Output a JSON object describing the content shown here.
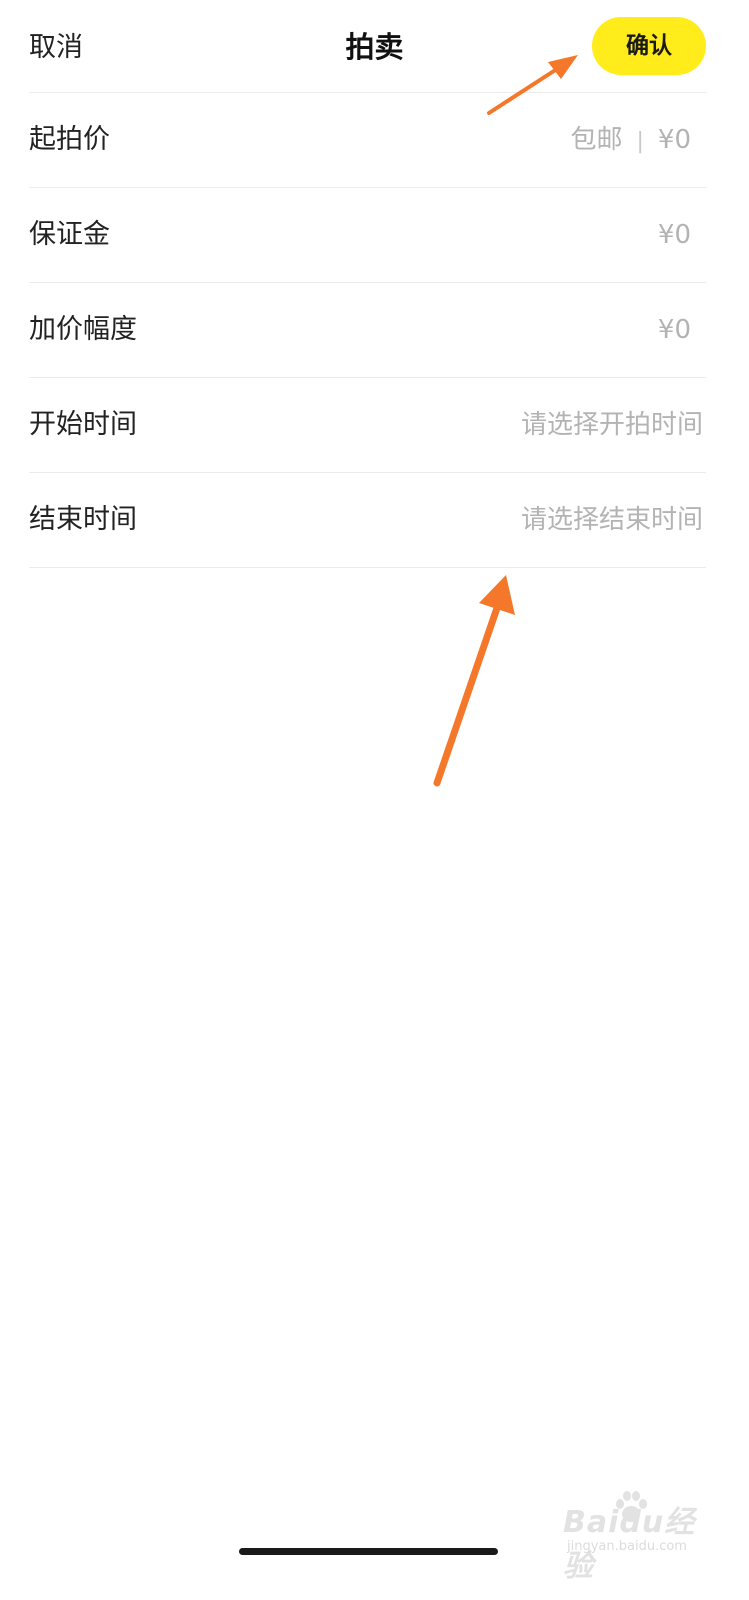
{
  "header": {
    "cancel_label": "取消",
    "title": "拍卖",
    "confirm_label": "确认"
  },
  "form": {
    "rows": [
      {
        "label": "起拍价",
        "shipping": "包邮",
        "separator": "|",
        "value": "¥0"
      },
      {
        "label": "保证金",
        "value": "¥0"
      },
      {
        "label": "加价幅度",
        "value": "¥0"
      },
      {
        "label": "开始时间",
        "placeholder": "请选择开拍时间"
      },
      {
        "label": "结束时间",
        "placeholder": "请选择结束时间"
      }
    ]
  },
  "watermark": {
    "text": "Baidu经验",
    "sub": "jingyan.baidu.com"
  },
  "colors": {
    "accent": "#ffec1a",
    "annotation_arrow": "#f5782a",
    "placeholder_text": "#b3b3b3"
  },
  "icons": [
    "annotation-arrow-icon",
    "baidu-paw-icon"
  ]
}
